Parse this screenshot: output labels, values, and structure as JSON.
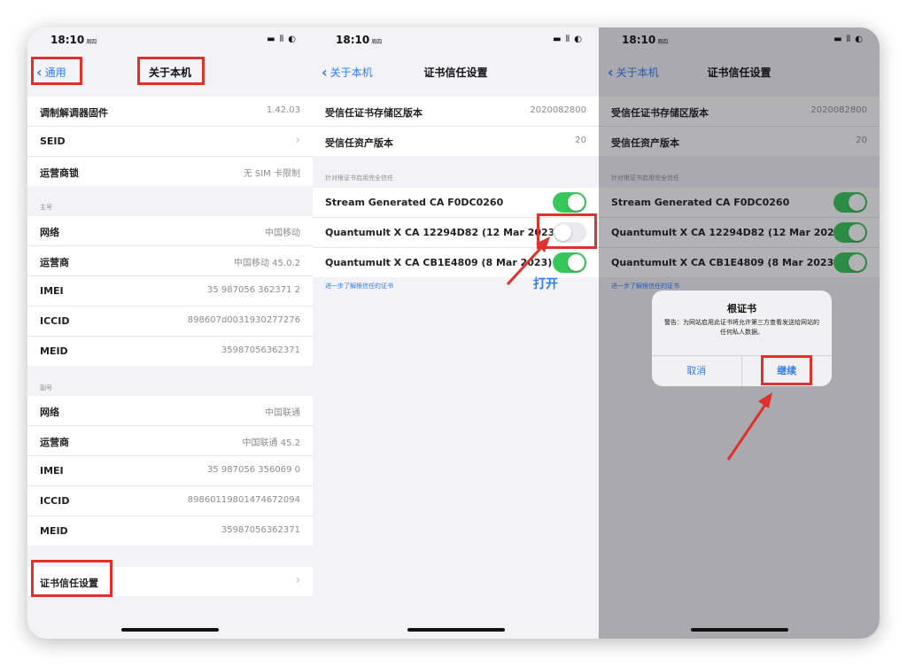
{
  "colors": {
    "accent": "#2f7cf6",
    "toggle_on": "#35c759",
    "annotation": "#e0322b",
    "background": "#f2f2f7"
  },
  "panel1": {
    "time": "18:10",
    "time_suffix": "周四",
    "nav_back": "通用",
    "nav_title": "关于本机",
    "top_rows": [
      {
        "label": "调制解调器固件",
        "value": "1.42.03"
      },
      {
        "label": "SEID",
        "value": ""
      },
      {
        "label": "运营商锁",
        "value": "无 SIM 卡限制"
      }
    ],
    "primary_label": "主号",
    "primary_rows": [
      {
        "label": "网络",
        "value": "中国移动"
      },
      {
        "label": "运营商",
        "value": "中国移动 45.0.2"
      },
      {
        "label": "IMEI",
        "value": "35 987056 362371 2"
      },
      {
        "label": "ICCID",
        "value": "898607d0031930277276"
      },
      {
        "label": "MEID",
        "value": "35987056362371"
      }
    ],
    "secondary_label": "副号",
    "secondary_rows": [
      {
        "label": "网络",
        "value": "中国联通"
      },
      {
        "label": "运营商",
        "value": "中国联通 45.2"
      },
      {
        "label": "IMEI",
        "value": "35 987056 356069 0"
      },
      {
        "label": "ICCID",
        "value": "89860119801474672094"
      },
      {
        "label": "MEID",
        "value": "35987056362371"
      }
    ],
    "cert_trust_label": "证书信任设置"
  },
  "panel2": {
    "time": "18:10",
    "time_suffix": "周四",
    "nav_back": "关于本机",
    "nav_title": "证书信任设置",
    "info_rows": [
      {
        "label": "受信任证书存储区版本",
        "value": "2020082800"
      },
      {
        "label": "受信任资产版本",
        "value": "20"
      }
    ],
    "section_label": "针对根证书启用完全信任",
    "certs": [
      {
        "label": "Stream Generated CA F0DC0260",
        "on": true
      },
      {
        "label": "Quantumult X CA 12294D82 (12 Mar 2023)",
        "on": false
      },
      {
        "label": "Quantumult X CA CB1E4809 (8 Mar 2023)",
        "on": true
      }
    ],
    "learn_more": "进一步了解根信任的证书",
    "annotation_text": "打开"
  },
  "panel3": {
    "time": "18:10",
    "time_suffix": "周四",
    "nav_back": "关于本机",
    "nav_title": "证书信任设置",
    "info_rows": [
      {
        "label": "受信任证书存储区版本",
        "value": "2020082800"
      },
      {
        "label": "受信任资产版本",
        "value": "20"
      }
    ],
    "section_label": "针对根证书启用完全信任",
    "certs": [
      {
        "label": "Stream Generated CA F0DC0260",
        "on": true
      },
      {
        "label": "Quantumult X CA 12294D82 (12 Mar 2023)",
        "on": true
      },
      {
        "label": "Quantumult X CA CB1E4809 (8 Mar 2023)",
        "on": true
      }
    ],
    "learn_more": "进一步了解根信任的证书",
    "alert": {
      "title": "根证书",
      "message": "警告：为网站启用此证书将允许第三方查看发送给网站的任何私人数据。",
      "cancel": "取消",
      "continue": "继续"
    }
  }
}
